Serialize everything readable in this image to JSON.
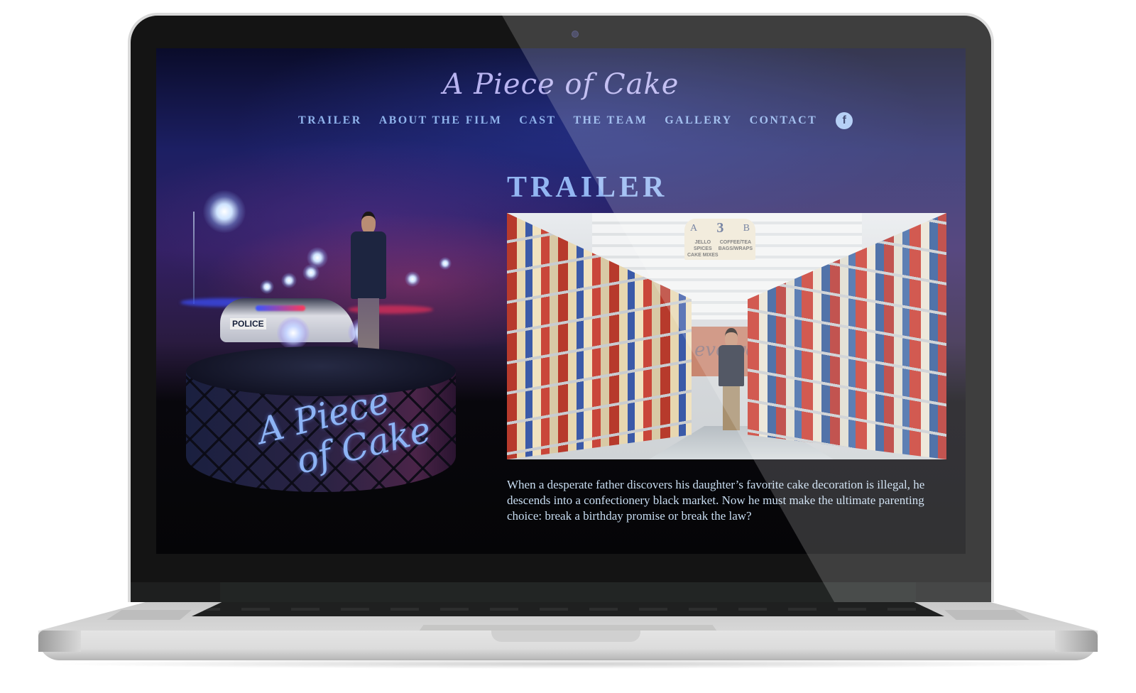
{
  "site": {
    "title": "A Piece of Cake",
    "accent_color": "#93b6f2",
    "nav": [
      {
        "label": "TRAILER"
      },
      {
        "label": "ABOUT THE FILM"
      },
      {
        "label": "CAST"
      },
      {
        "label": "THE TEAM"
      },
      {
        "label": "GALLERY"
      },
      {
        "label": "CONTACT"
      }
    ],
    "social": {
      "icon": "facebook-icon",
      "glyph": "f"
    }
  },
  "poster": {
    "title_line1": "A Piece",
    "title_line2": "of Cake",
    "car_label": "POLICE"
  },
  "trailer": {
    "heading": "TRAILER",
    "video_sign": {
      "left": "A",
      "number": "3",
      "right": "B",
      "categories_left": [
        "JELLO",
        "SPICES",
        "CAKE MIXES"
      ],
      "categories_right": [
        "COFFEE/TEA",
        "BAGS/WRAPS"
      ]
    },
    "back_wall_text": "everyday",
    "synopsis": "When a desperate father discovers his daughter’s favorite cake decoration is illegal, he descends into a confectionery black market. Now he must make the ultimate parenting choice: break a birthday promise or break the law?"
  }
}
